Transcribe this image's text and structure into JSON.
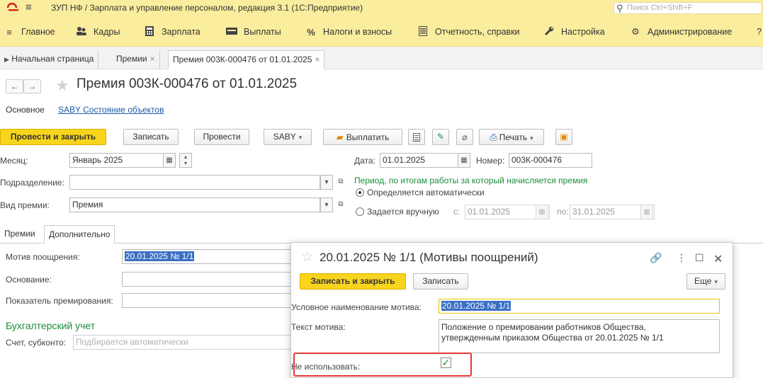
{
  "window": {
    "title": "ЗУП НФ / Зарплата и управление персоналом, редакция 3.1  (1С:Предприятие)",
    "search_placeholder": "Поиск Ctrl+Shift+F",
    "logo_text": "1C"
  },
  "menu": [
    {
      "icon": "≡",
      "label": "Главное"
    },
    {
      "icon": "👥",
      "label": "Кадры"
    },
    {
      "icon": "▦",
      "label": "Зарплата"
    },
    {
      "icon": "▬",
      "label": "Выплаты"
    },
    {
      "icon": "%",
      "label": "Налоги и взносы"
    },
    {
      "icon": "▤",
      "label": "Отчетность, справки"
    },
    {
      "icon": "🔧",
      "label": "Настройка"
    },
    {
      "icon": "⚙",
      "label": "Администрирование"
    },
    {
      "icon": "",
      "label": "?"
    }
  ],
  "tabs": {
    "home": "Начальная страница",
    "premii": "Премии",
    "doc": "Премия 003К-000476 от 01.01.2025"
  },
  "doc": {
    "title": "Премия 003К-000476 от 01.01.2025",
    "sub_main": "Основное",
    "sub_saby": "SABY Состояние объектов"
  },
  "toolbar": {
    "post_close": "Провести и закрыть",
    "save": "Записать",
    "post": "Провести",
    "saby": "SABY",
    "pay": "Выплатить",
    "print": "Печать"
  },
  "form": {
    "month_label": "Месяц:",
    "month_value": "Январь 2025",
    "dept_label": "Подразделение:",
    "dept_value": "",
    "type_label": "Вид премии:",
    "type_value": "Премия",
    "date_label": "Дата:",
    "date_value": "01.01.2025",
    "number_label": "Номер:",
    "number_value": "003К-000476",
    "period_title": "Период, по итогам работы за который начисляется премия",
    "radio_auto": "Определяется автоматически",
    "radio_manual": "Задается вручную",
    "from_label": "с:",
    "from_value": "01.01.2025",
    "to_label": "по:",
    "to_value": "31.01.2025"
  },
  "lower_tabs": {
    "premii": "Премии",
    "extra": "Дополнительно"
  },
  "extra": {
    "motive_label": "Мотив поощрения:",
    "motive_value": "20.01.2025 № 1/1",
    "basis_label": "Основание:",
    "indicator_label": "Показатель премирования:",
    "accounting_title": "Бухгалтерский учет",
    "account_label": "Счет, субконто:",
    "account_placeholder": "Подбирается автоматически"
  },
  "popup": {
    "title": "20.01.2025 № 1/1 (Мотивы поощрений)",
    "save_close": "Записать и закрыть",
    "save": "Записать",
    "more": "Еще",
    "name_label": "Условное наименование мотива:",
    "name_value": "20.01.2025 № 1/1",
    "text_label": "Текст мотива:",
    "text_line1": "Положение о премировании работников Общества,",
    "text_line2": "утвержденным приказом Общества от 20.01.2025 № 1/1",
    "not_use_label": "Не использовать:",
    "not_use_checked": true
  },
  "colors": {
    "menu_bg": "#fbed9e",
    "primary_button": "#f8d51c",
    "link": "#1a5ca8",
    "green_text": "#1a8d3a",
    "highlight": "#e53935",
    "selection": "#3a6fc4"
  }
}
